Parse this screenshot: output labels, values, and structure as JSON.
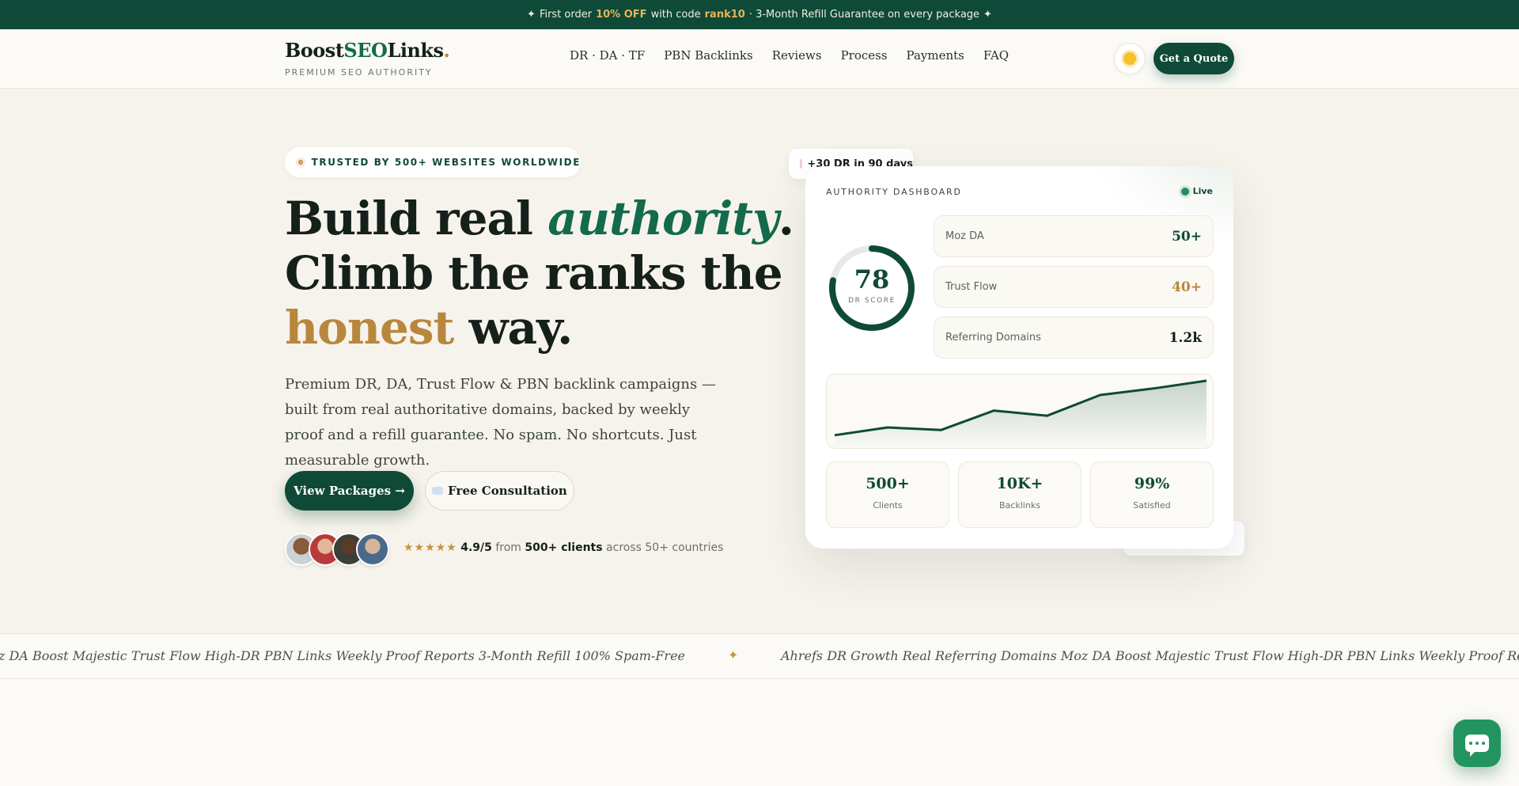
{
  "announcement": {
    "prefix_icon": "✦",
    "text_1": "First order",
    "discount": "10% OFF",
    "text_2": "with code",
    "code": "rank10",
    "text_3": "· 3-Month Refill Guarantee on every package",
    "suffix_icon": "✦"
  },
  "header": {
    "logo": {
      "part1": "Boost",
      "part2": "SEO",
      "part3": "Links",
      "dot": ".",
      "tagline": "PREMIUM SEO AUTHORITY"
    },
    "nav": [
      "DR · DA · TF",
      "PBN Backlinks",
      "Reviews",
      "Process",
      "Payments",
      "FAQ"
    ],
    "theme_toggle_icon": "sun-icon",
    "cta": "Get a Quote"
  },
  "hero": {
    "badge": "TRUSTED BY 500+ WEBSITES WORLDWIDE",
    "headline": {
      "line1_a": "Build real ",
      "line1_b": "authority",
      "line1_c": ".",
      "line2": "Climb the ranks the",
      "line3_a": "honest",
      "line3_b": " way."
    },
    "subcopy": "Premium DR, DA, Trust Flow & PBN backlink campaigns — built from real authoritative domains, backed by weekly proof and a refill guarantee. No spam. No shortcuts. Just measurable growth.",
    "primary_button": "View Packages →",
    "secondary_button": "Free Consultation",
    "proof": {
      "stars": "★★★★★",
      "rating": "4.9/5",
      "from": "from",
      "clients": "500+ clients",
      "countries": "across 50+ countries"
    }
  },
  "dashboard": {
    "float_tag": "+30 DR in 90 days",
    "title": "AUTHORITY DASHBOARD",
    "live": "Live",
    "dr_score": {
      "value": "78",
      "label": "DR SCORE",
      "fraction": 0.78
    },
    "metrics": [
      {
        "label": "Moz DA",
        "value": "50+",
        "color": "#0f4a38"
      },
      {
        "label": "Trust Flow",
        "value": "40+",
        "color": "#b8873e"
      },
      {
        "label": "Referring Domains",
        "value": "1.2k",
        "color": "#16201b"
      }
    ],
    "trend": [
      10,
      22,
      18,
      48,
      40,
      72,
      82,
      94
    ],
    "stats": [
      {
        "value": "500+",
        "label": "Clients"
      },
      {
        "value": "10K+",
        "label": "Backlinks"
      },
      {
        "value": "99%",
        "label": "Satisfied"
      }
    ]
  },
  "marquee": {
    "left_text": "Referring Domains Moz DA Boost Majestic Trust Flow High-DR PBN Links Weekly Proof Reports 3-Month Refill 100% Spam-Free",
    "separator": "✦",
    "right_text": "Ahrefs DR Growth Real Referring Domains Moz DA Boost Majestic Trust Flow High-DR PBN Links Weekly Proof Reports 3-Month Refill 100% Spam-Free"
  },
  "chat_fab_icon": "chat-icon",
  "colors": {
    "brand": "#0f4a38",
    "accent_gold": "#b8873e",
    "chat": "#24945f"
  }
}
